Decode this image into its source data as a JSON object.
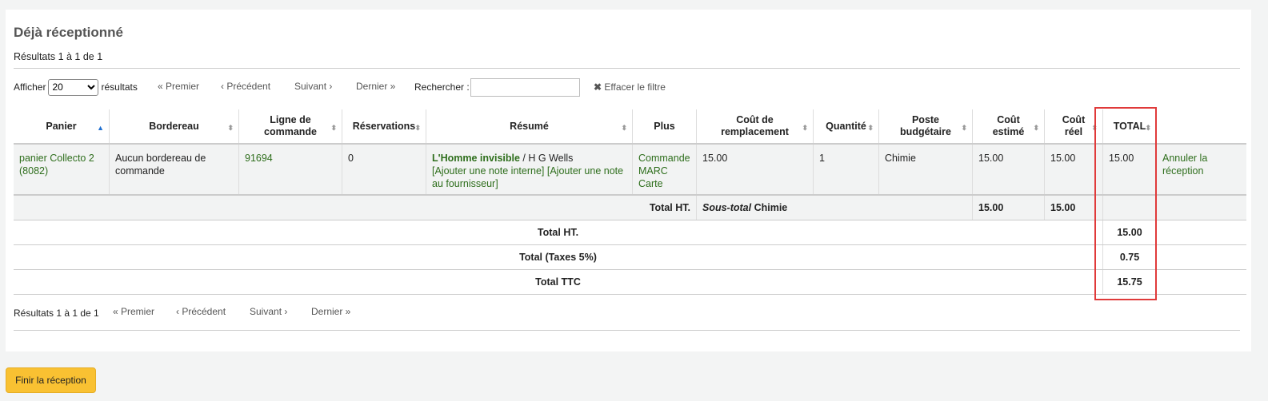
{
  "page": {
    "title": "Déjà réceptionné",
    "results_top": "Résultats 1 à 1 de 1",
    "results_bottom": "Résultats 1 à 1 de 1",
    "finish_button": "Finir la réception"
  },
  "controls": {
    "show_label": "Afficher",
    "show_value": "20",
    "show_suffix": "résultats",
    "first": "« Premier",
    "previous": "‹ Précédent",
    "next": "Suivant ›",
    "last": "Dernier »",
    "search_label": "Rechercher :",
    "search_value": "",
    "clear_filter": "Effacer le filtre"
  },
  "table": {
    "headers": {
      "basket": "Panier",
      "invoice": "Bordereau",
      "order_line": "Ligne de commande",
      "reservations": "Réservations",
      "summary": "Résumé",
      "more": "Plus",
      "replacement_cost": "Coût de remplacement",
      "quantity": "Quantité",
      "budget_line": "Poste budgétaire",
      "estimated_cost": "Coût estimé",
      "actual_cost": "Coût réel",
      "total": "TOTAL"
    },
    "row": {
      "basket": "panier Collecto 2 (8082)",
      "invoice": "Aucun bordereau de commande",
      "order_line": "91694",
      "reservations": "0",
      "title": "L'Homme invisible",
      "author": " / H G Wells",
      "add_internal_note": "[Ajouter une note interne]",
      "add_vendor_note": "[Ajouter une note au fournisseur]",
      "more_order": "Commande",
      "more_marc": "MARC",
      "more_card": "Carte",
      "replacement_cost": "15.00",
      "quantity": "1",
      "budget_line": "Chimie",
      "estimated_cost": "15.00",
      "actual_cost": "15.00",
      "total": "15.00",
      "cancel_receipt": "Annuler la réception"
    },
    "subtotal": {
      "label": "Total HT.",
      "subtotal_italic": "Sous-total",
      "subtotal_name": " Chimie",
      "estimated": "15.00",
      "actual": "15.00"
    },
    "totals": [
      {
        "label": "Total HT.",
        "value": "15.00"
      },
      {
        "label": "Total (Taxes 5%)",
        "value": "0.75"
      },
      {
        "label": "Total TTC",
        "value": "15.75"
      }
    ]
  },
  "colors": {
    "link_green": "#2e6e1c",
    "highlight_red": "#e03a3a",
    "button_yellow": "#f9c132"
  }
}
